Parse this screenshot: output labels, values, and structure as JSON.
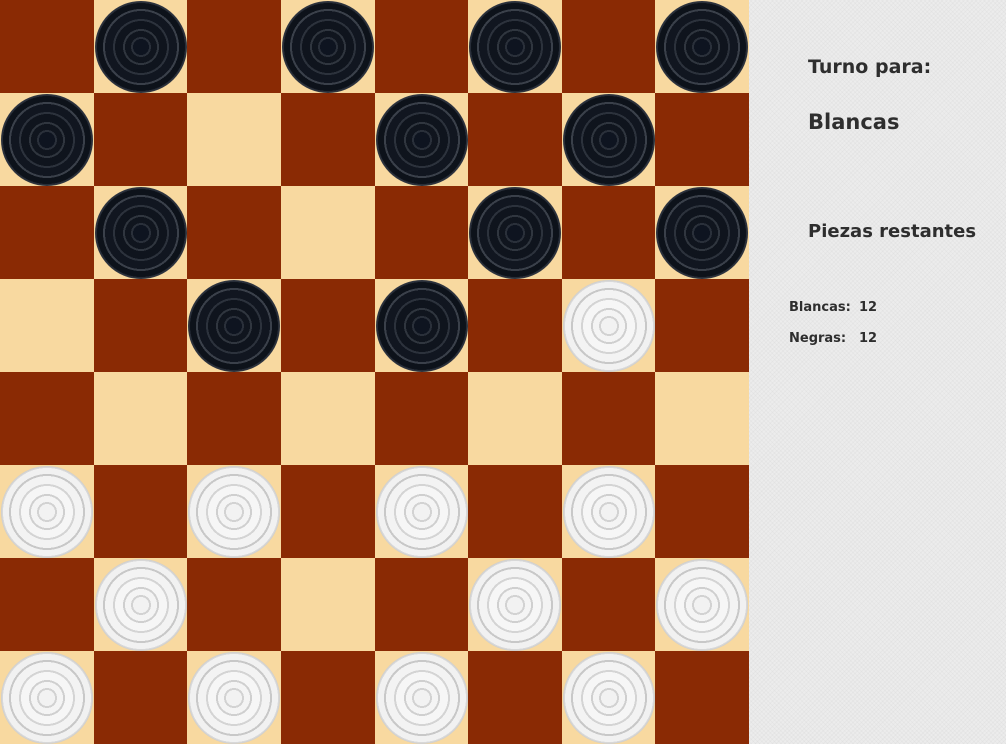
{
  "game": "Damas",
  "colors": {
    "light_square": "#f8d9a0",
    "dark_square": "#8a2a04",
    "black_piece": "#0e1420",
    "white_piece": "#f2f2f2",
    "sidebar_text": "#2e2e2e"
  },
  "board": {
    "size": 8,
    "rows": [
      ".b.b.b.b",
      "b...b.b.",
      ".b...b.b",
      "..b.b.w.",
      "........",
      "w.w.w.w.",
      ".w...w.w",
      "w.w.w.w."
    ],
    "legend": {
      "b": "black",
      "w": "white",
      ".": "empty"
    }
  },
  "sidebar": {
    "turn_heading": "Turno para:",
    "turn_value": "Blancas",
    "pieces_heading": "Piezas restantes",
    "white_label": "Blancas:",
    "white_count": "12",
    "black_label": "Negras:",
    "black_count": "12"
  }
}
